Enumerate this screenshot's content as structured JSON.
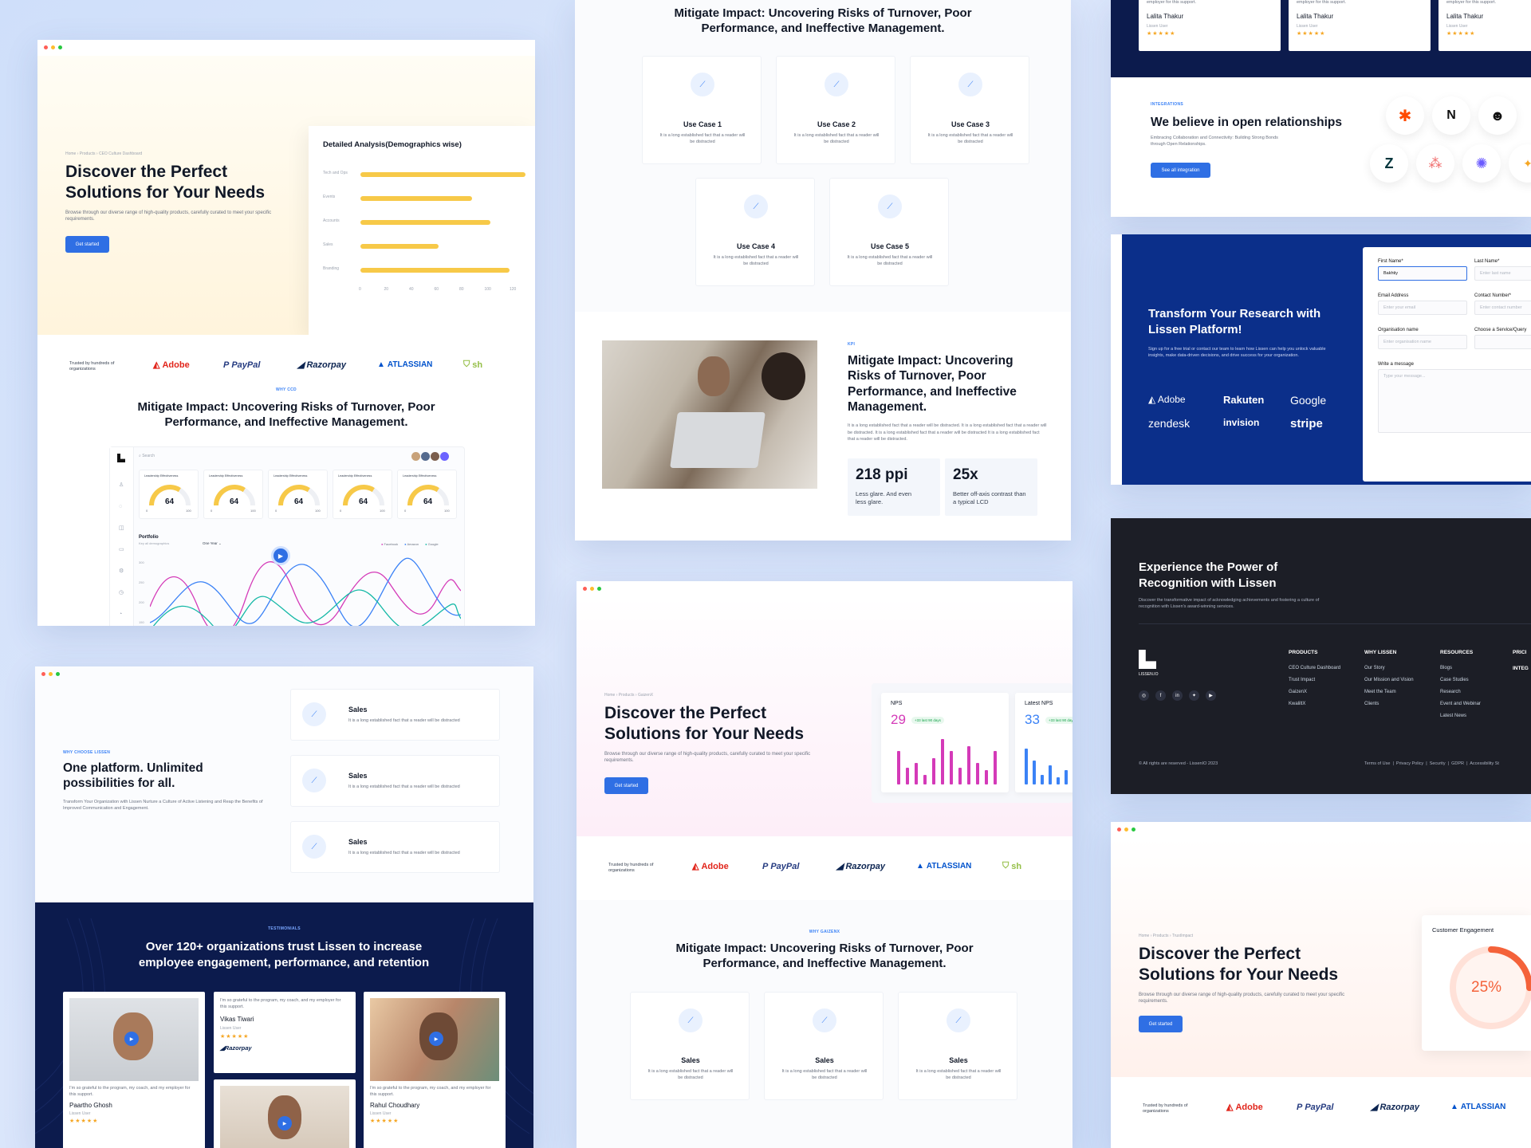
{
  "colors": {
    "accent": "#2f6fe4",
    "navy": "#0c1b4d",
    "brand_blue": "#0b2f8a",
    "dark": "#1c1e26",
    "bar": "#f7c948",
    "nps_pink": "#d43ab8",
    "nps_blue": "#3b82f6"
  },
  "hero": {
    "crumb_a": "Home › Products › CEO Culture Dashboard",
    "crumb_b": "Home › Products › GaizenX",
    "crumb_c": "Home › Products › TrustImpact",
    "title": "Discover the Perfect Solutions for Your Needs",
    "desc": "Browse through our diverse range of high-quality products, carefully curated to meet your specific requirements.",
    "cta": "Get started"
  },
  "demographics": {
    "title": "Detailed Analysis(Demographics wise)",
    "rows": [
      {
        "label": "Tech and Ops",
        "value": 118
      },
      {
        "label": "Events",
        "value": 80
      },
      {
        "label": "Accounts",
        "value": 93
      },
      {
        "label": "Sales",
        "value": 56
      },
      {
        "label": "Branding",
        "value": 107
      }
    ],
    "ticks": [
      "0",
      "20",
      "40",
      "60",
      "80",
      "100",
      "120"
    ]
  },
  "trusted": {
    "label": "Trusted by hundreds of organizations",
    "logos": [
      "Adobe",
      "PayPal",
      "Razorpay",
      "ATLASSIAN",
      "sh"
    ]
  },
  "why": {
    "tag_ceo": "WHY CCD",
    "tag_gaizen": "WHY GAIZENX",
    "title": "Mitigate Impact: Uncovering Risks of Turnover, Poor Performance, and Ineffective Management."
  },
  "dashboard": {
    "search": "Search",
    "gauge_label": "Leadership Effectiveness",
    "gauge_value": "64",
    "gauge_min": "0",
    "gauge_max": "100",
    "portfolio": "Portfolio",
    "portfolio_sub": "Key all demographics",
    "dropdown": "One Year",
    "legend": [
      "Facebook",
      "Amazon",
      "Google"
    ],
    "yticks": [
      "300",
      "250",
      "200",
      "150",
      "100"
    ],
    "gauges": [
      0.68,
      0.68,
      0.68,
      0.68,
      0.68
    ]
  },
  "usecases": {
    "desc": "It is a long established fact that a reader will be distracted",
    "items": [
      "Use Case 1",
      "Use Case 2",
      "Use Case 3",
      "Use Case 4",
      "Use Case 5"
    ],
    "sales": "Sales"
  },
  "kpi": {
    "tag": "KPI",
    "title": "Mitigate Impact: Uncovering Risks of Turnover, Poor Performance, and Ineffective Management.",
    "desc": "It is a long established fact that a reader will be distracted. It is a long established fact that a reader will be distracted. It is a long established fact that a reader will be distracted It is a long established fact that a reader will be distracted.",
    "stat1_value": "218 ppi",
    "stat1_desc": "Less glare. And even less glare.",
    "stat2_value": "25x",
    "stat2_desc": "Better off-axis contrast than a typical LCD"
  },
  "why_lissen": {
    "tag": "WHY CHOOSE LISSEN",
    "title": "One platform. Unlimited possibilities for all.",
    "desc": "Transform Your Organization with Lissen Nurture a Culture of Active Listening and Reap the Benefits of Improved Communication and Engagement.",
    "item_title": "Sales",
    "item_desc": "It is a long established fact that a reader will be distracted"
  },
  "testimonials": {
    "tag": "TESTIMONIALS",
    "title": "Over 120+ organizations trust Lissen to increase employee engagement, performance, and retention",
    "quote": "I'm so grateful to the program, my coach, and my employer for this support.",
    "role": "Lissen User",
    "people": [
      "Paartho Ghosh",
      "Vikas Tiwari",
      "Rahul Choudhary"
    ],
    "razorpay": "Razorpay",
    "top_name": "Lalita Thakur",
    "top_quote": "employer for this support.",
    "stars": "★★★★★"
  },
  "nps": {
    "label": "NPS",
    "value": "29",
    "badge": "+33 last 90 days",
    "latest_label": "Latest NPS",
    "latest_value": "33",
    "latest_badge": "+33 last 90 days",
    "bars": [
      0.7,
      0.35,
      0.45,
      0.2,
      0.55,
      0.95,
      0.7,
      0.35,
      0.8,
      0.45,
      0.3,
      0.7
    ],
    "bars2": [
      0.75,
      0.5,
      0.2,
      0.4,
      0.15,
      0.3,
      0.85,
      0.6
    ]
  },
  "integrations": {
    "tag": "INTEGRATIONS",
    "title": "We believe in open relationships",
    "desc": "Embracing Collaboration and Connectivity: Building Strong Bonds through Open Relationships.",
    "cta": "See all integration"
  },
  "research": {
    "title": "Transform Your Research with Lissen Platform!",
    "desc": "Sign up for a free trial or contact our team to learn how Lissen can help you unlock valuable insights, make data-driven decisions, and drive success for your organization.",
    "logos": [
      "Adobe",
      "Rakuten",
      "Google",
      "zendesk",
      "invision",
      "stripe"
    ],
    "first_name_label": "First Name*",
    "first_name_value": "Bakhtiy",
    "last_name_label": "Last Name*",
    "last_name_ph": "Enter last name",
    "email_label": "Email Address",
    "email_ph": "Enter your email",
    "contact_label": "Contact Number*",
    "contact_ph": "Enter contact number",
    "org_label": "Organisation name",
    "org_ph": "Enter organisation name",
    "service_label": "Choose a Service/Query",
    "message_label": "Write a message",
    "message_ph": "Type your message..."
  },
  "footer": {
    "title": "Experience the Power of Recognition with Lissen",
    "desc": "Discover the transformative impact of acknowledging achievements and fostering a culture of recognition with Lissen's award-winning services.",
    "brand": "LISSEN.IO",
    "products_h": "PRODUCTS",
    "products": [
      "CEO Culture Dashboard",
      "Trust Impact",
      "GaizenX",
      "KwaliltX"
    ],
    "why_h": "WHY LISSEN",
    "why": [
      "Our Story",
      "Our Mission and Vision",
      "Meet the Team",
      "Clients"
    ],
    "res_h": "RESOURCES",
    "res": [
      "Blogs",
      "Case Studies",
      "Research",
      "Event and Webinar",
      "Latest News"
    ],
    "pricing_h": "PRICI",
    "integ_h": "INTEG",
    "copyright": "© All rights are reserved - LissenIO 2023",
    "links": "Terms of Use  |  Privacy Policy  |  Security  |  GDPR  |  Accessibility St"
  },
  "engagement": {
    "title": "Customer Engagement",
    "value": "25%",
    "fraction": 0.25
  }
}
